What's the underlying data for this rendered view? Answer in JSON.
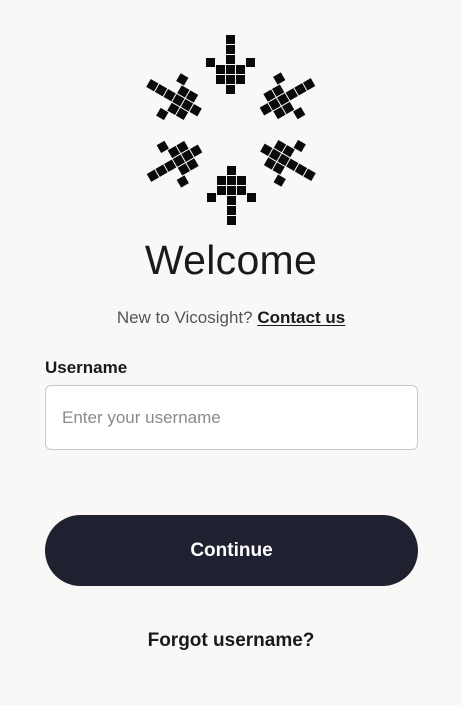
{
  "brand": {
    "logo_icon": "pixel-arrows-ring-icon"
  },
  "login": {
    "title": "Welcome",
    "signup_prompt": "New to Vicosight?",
    "signup_link": "Contact us",
    "username_label": "Username",
    "username_value": "",
    "username_placeholder": "Enter your username",
    "continue_label": "Continue",
    "forgot_label": "Forgot username?"
  },
  "colors": {
    "background": "#f9f8f6",
    "primary_button": "#1f2030",
    "text": "#1a1a1a"
  }
}
